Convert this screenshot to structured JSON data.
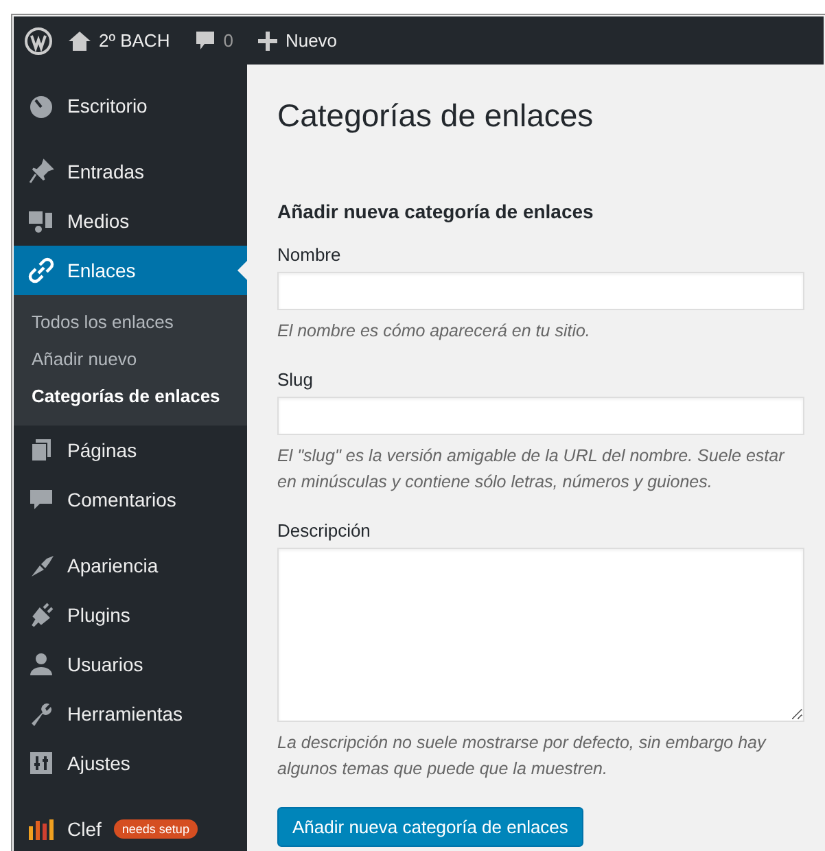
{
  "admin_bar": {
    "site": "2º BACH",
    "comments": "0",
    "new": "Nuevo"
  },
  "sidebar": {
    "groups": [
      {
        "items": [
          {
            "label": "Escritorio",
            "selected": false
          }
        ]
      },
      {
        "items": [
          {
            "label": "Entradas",
            "selected": false
          },
          {
            "label": "Medios",
            "selected": false
          },
          {
            "label": "Enlaces",
            "selected": true,
            "children": [
              {
                "label": "Todos los enlaces",
                "selected": false
              },
              {
                "label": "Añadir nuevo",
                "selected": false
              },
              {
                "label": "Categorías de enlaces",
                "selected": true
              }
            ]
          },
          {
            "label": "Páginas",
            "selected": false
          },
          {
            "label": "Comentarios",
            "selected": false
          }
        ]
      },
      {
        "items": [
          {
            "label": "Apariencia",
            "selected": false
          },
          {
            "label": "Plugins",
            "selected": false
          },
          {
            "label": "Usuarios",
            "selected": false
          },
          {
            "label": "Herramientas",
            "selected": false
          },
          {
            "label": "Ajustes",
            "selected": false
          }
        ]
      },
      {
        "items": [
          {
            "label": "Clef",
            "selected": false,
            "badge": "needs setup"
          }
        ]
      }
    ]
  },
  "page": {
    "title": "Categorías de enlaces",
    "form_title": "Añadir nueva categoría de enlaces",
    "fields": [
      {
        "kind": "input",
        "label": "Nombre",
        "hint": "El nombre es cómo aparecerá en tu sitio."
      },
      {
        "kind": "input",
        "label": "Slug",
        "hint": "El \"slug\" es la versión amigable de la URL del nombre. Suele estar en minúsculas y contiene sólo letras, números y guiones."
      },
      {
        "kind": "textarea",
        "label": "Descripción",
        "hint": "La descripción no suele mostrarse por defecto, sin embargo hay algunos temas que puede que la muestren."
      }
    ],
    "submit": "Añadir nueva categoría de enlaces"
  }
}
